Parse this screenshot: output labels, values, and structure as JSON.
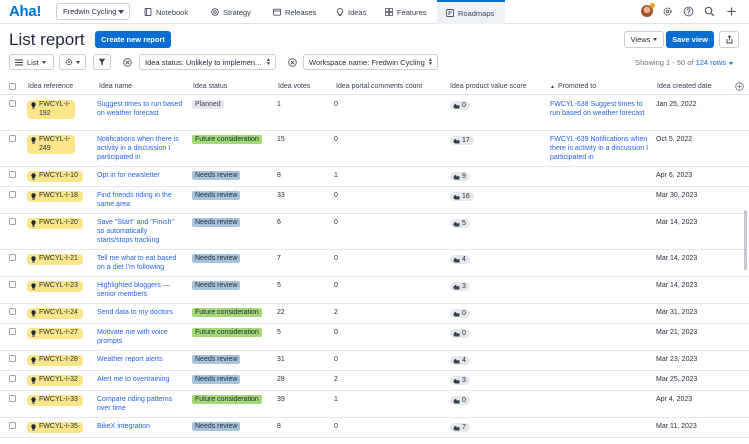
{
  "app": {
    "logo": "Aha!",
    "workspace": "Fredwin Cycling"
  },
  "nav": {
    "tabs": [
      {
        "label": "Notebook",
        "icon": "notebook-icon"
      },
      {
        "label": "Strategy",
        "icon": "strategy-icon"
      },
      {
        "label": "Releases",
        "icon": "releases-icon"
      },
      {
        "label": "Ideas",
        "icon": "ideas-icon"
      },
      {
        "label": "Features",
        "icon": "features-icon"
      },
      {
        "label": "Roadmaps",
        "icon": "roadmaps-icon",
        "active": true
      }
    ]
  },
  "header": {
    "title": "List report",
    "create_label": "Create new report",
    "views_label": "Views",
    "save_view_label": "Save view"
  },
  "filters": {
    "list_label": "List",
    "idea_status": "Idea status: Unlikely to implemen...",
    "workspace_filter": "Workspace name: Fredwin Cycling",
    "showing_prefix": "Showing 1 - 50 of",
    "showing_rows": "124 rows"
  },
  "table": {
    "columns": [
      "Idea reference",
      "Idea name",
      "Idea status",
      "Idea votes",
      "Idea portal comments count",
      "Idea product value score",
      "Promoted to",
      "Idea created date"
    ],
    "rows": [
      {
        "ref": [
          "FWCYL-I-",
          "192"
        ],
        "name": "Suggest times to run based on weather forecast",
        "status": "Planned",
        "status_type": "planned",
        "votes": "1",
        "comments": "0",
        "score": "0",
        "promoted": "FWCYL-638 Suggest times to run based on weather forecast",
        "date": "Jan 25, 2022"
      },
      {
        "ref": [
          "FWCYL-I-",
          "249"
        ],
        "name": "Notifications when there is activity in a discussion I participated in",
        "status": "Future consideration",
        "status_type": "future",
        "votes": "15",
        "comments": "0",
        "score": "17",
        "promoted": "FWCYL-639 Notifications when there is activity in a discussion I participated in",
        "date": "Oct 5, 2022"
      },
      {
        "ref": [
          "FWCYL-I-10"
        ],
        "name": "Opt in for newsletter",
        "status": "Needs review",
        "status_type": "review",
        "votes": "8",
        "comments": "1",
        "score": "9",
        "promoted": "",
        "date": "Apr 6, 2023"
      },
      {
        "ref": [
          "FWCYL-I-18"
        ],
        "name": "Find friends riding in the same area",
        "status": "Needs review",
        "status_type": "review",
        "votes": "33",
        "comments": "0",
        "score": "16",
        "promoted": "",
        "date": "Mar 30, 2023"
      },
      {
        "ref": [
          "FWCYL-I-20"
        ],
        "name": "Save \"Start\" and \"Finish\" so automatically starts/stops tracking",
        "status": "Needs review",
        "status_type": "review",
        "votes": "6",
        "comments": "0",
        "score": "5",
        "promoted": "",
        "date": "Mar 14, 2023"
      },
      {
        "ref": [
          "FWCYL-I-21"
        ],
        "name": "Tell me what to eat based on a diet I'm following",
        "status": "Needs review",
        "status_type": "review",
        "votes": "7",
        "comments": "0",
        "score": "4",
        "promoted": "",
        "date": "Mar 14, 2023"
      },
      {
        "ref": [
          "FWCYL-I-23"
        ],
        "name": "Highlighted bloggers — senior members",
        "status": "Needs review",
        "status_type": "review",
        "votes": "5",
        "comments": "0",
        "score": "3",
        "promoted": "",
        "date": "Mar 14, 2023"
      },
      {
        "ref": [
          "FWCYL-I-24"
        ],
        "name": "Send data to my doctors",
        "status": "Future consideration",
        "status_type": "future",
        "votes": "22",
        "comments": "2",
        "score": "0",
        "promoted": "",
        "date": "Mar 31, 2023"
      },
      {
        "ref": [
          "FWCYL-I-27"
        ],
        "name": "Motivate me with voice prompts",
        "status": "Future consideration",
        "status_type": "future",
        "votes": "5",
        "comments": "0",
        "score": "0",
        "promoted": "",
        "date": "Mar 21, 2023"
      },
      {
        "ref": [
          "FWCYL-I-28"
        ],
        "name": "Weather report alerts",
        "status": "Needs review",
        "status_type": "review",
        "votes": "31",
        "comments": "0",
        "score": "4",
        "promoted": "",
        "date": "Mar 23, 2023"
      },
      {
        "ref": [
          "FWCYL-I-32"
        ],
        "name": "Alert me to overtraining",
        "status": "Needs review",
        "status_type": "review",
        "votes": "28",
        "comments": "2",
        "score": "3",
        "promoted": "",
        "date": "Mar 25, 2023"
      },
      {
        "ref": [
          "FWCYL-I-33"
        ],
        "name": "Compare riding patterns over time",
        "status": "Future consideration",
        "status_type": "future",
        "votes": "39",
        "comments": "1",
        "score": "0",
        "promoted": "",
        "date": "Apr 4, 2023"
      },
      {
        "ref": [
          "FWCYL-I-35"
        ],
        "name": "BikeX integration",
        "status": "Needs review",
        "status_type": "review",
        "votes": "8",
        "comments": "0",
        "score": "7",
        "promoted": "",
        "date": "Mar 11, 2023"
      }
    ]
  }
}
